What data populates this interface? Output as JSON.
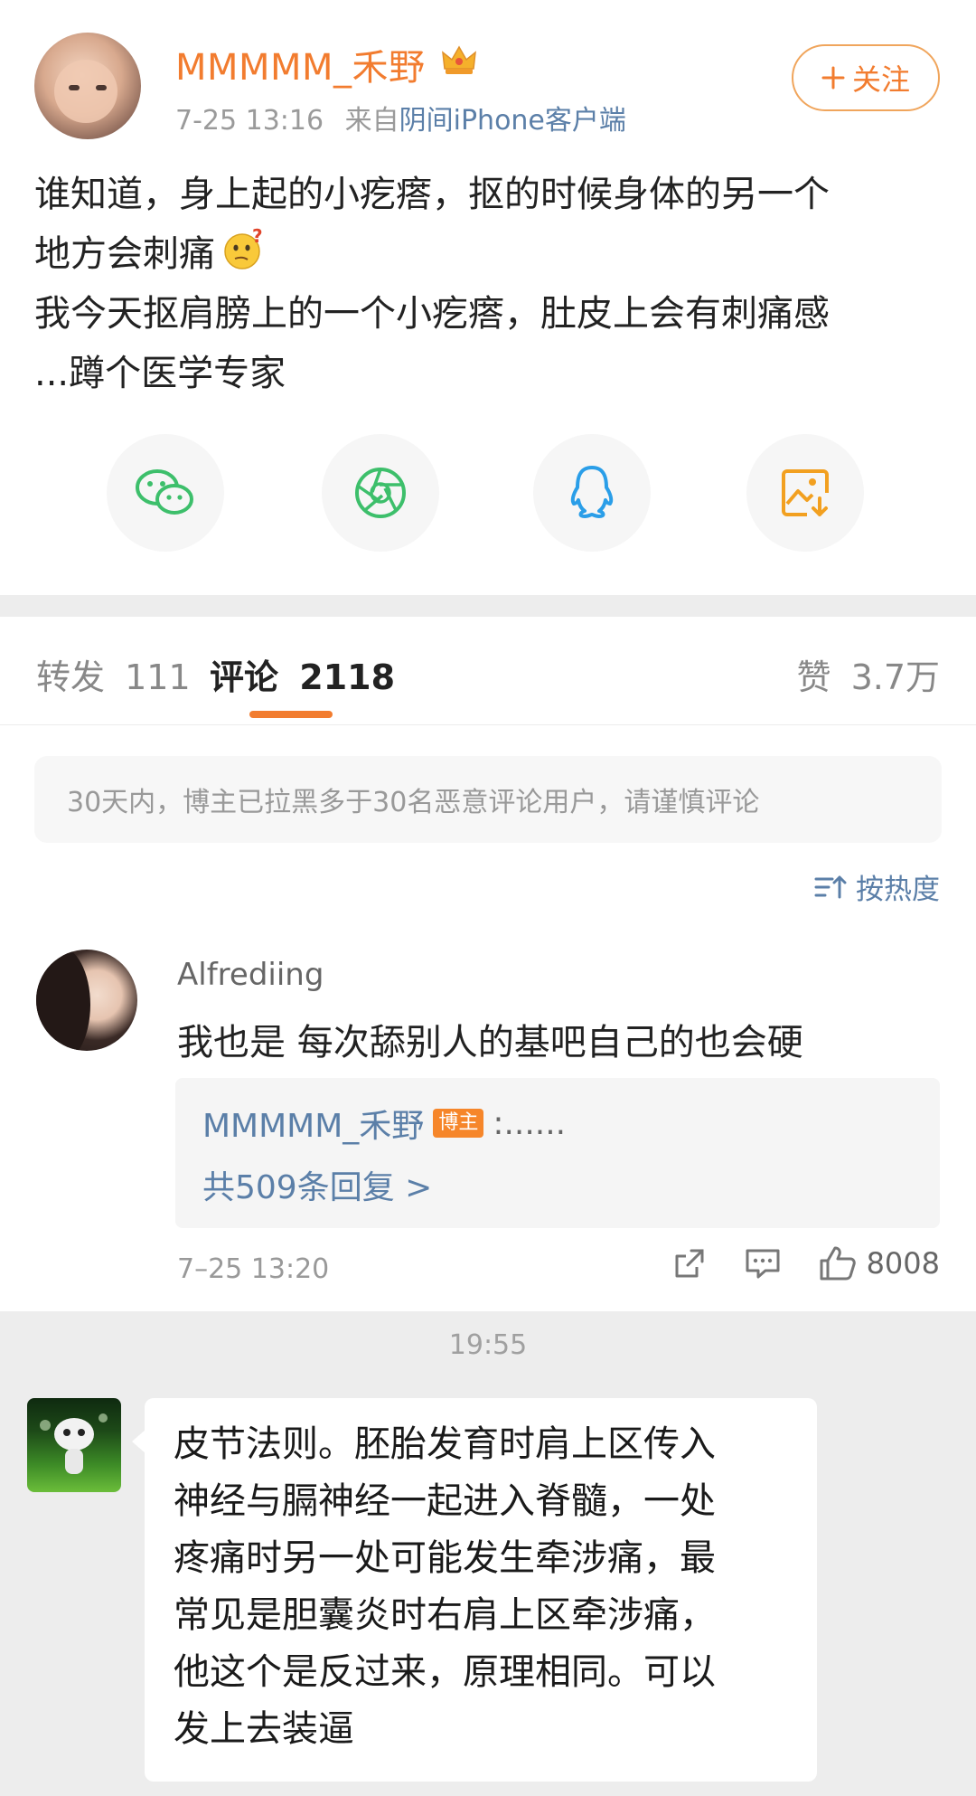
{
  "post": {
    "username": "MMMMM_禾野",
    "time": "7-25 13:16",
    "source_prefix": "来自",
    "source": "阴间iPhone客户端",
    "follow_label": "关注",
    "text_lines": [
      "谁知道，身上起的小疙瘩，抠的时候身体的另一个",
      "地方会刺痛",
      "我今天抠肩膀上的一个小疙瘩，肚皮上会有刺痛感",
      "...蹲个医学专家"
    ],
    "share_icons": [
      "wechat-icon",
      "moments-icon",
      "qq-icon",
      "save-image-icon"
    ]
  },
  "tabs": {
    "repost_label": "转发",
    "repost_count": "111",
    "comment_label": "评论",
    "comment_count": "2118",
    "like_label": "赞",
    "like_count": "3.7万"
  },
  "notice": "30天内，博主已拉黑多于30名恶意评论用户，请谨慎评论",
  "sort_label": "按热度",
  "comment": {
    "author": "Alfrediing",
    "text": "我也是 每次舔别人的基吧自己的也会硬",
    "reply_author": "MMMMM_禾野",
    "reply_badge": "博主",
    "reply_text": ":......",
    "reply_more": "共509条回复 >",
    "time": "7–25 13:20",
    "like_count": "8008"
  },
  "chat": {
    "time": "19:55",
    "message_lines": [
      "皮节法则。胚胎发育时肩上区传入",
      "神经与膈神经一起进入脊髓，一处",
      "疼痛时另一处可能发生牵涉痛，最",
      "常见是胆囊炎时右肩上区牵涉痛，",
      "他这个是反过来，原理相同。可以",
      "发上去装逼"
    ]
  },
  "colors": {
    "accent_orange": "#f27c2f",
    "link_blue": "#5b7fa8",
    "wechat_green": "#3dbf6b",
    "qq_blue": "#2a9ee8",
    "save_orange": "#f2a020"
  }
}
